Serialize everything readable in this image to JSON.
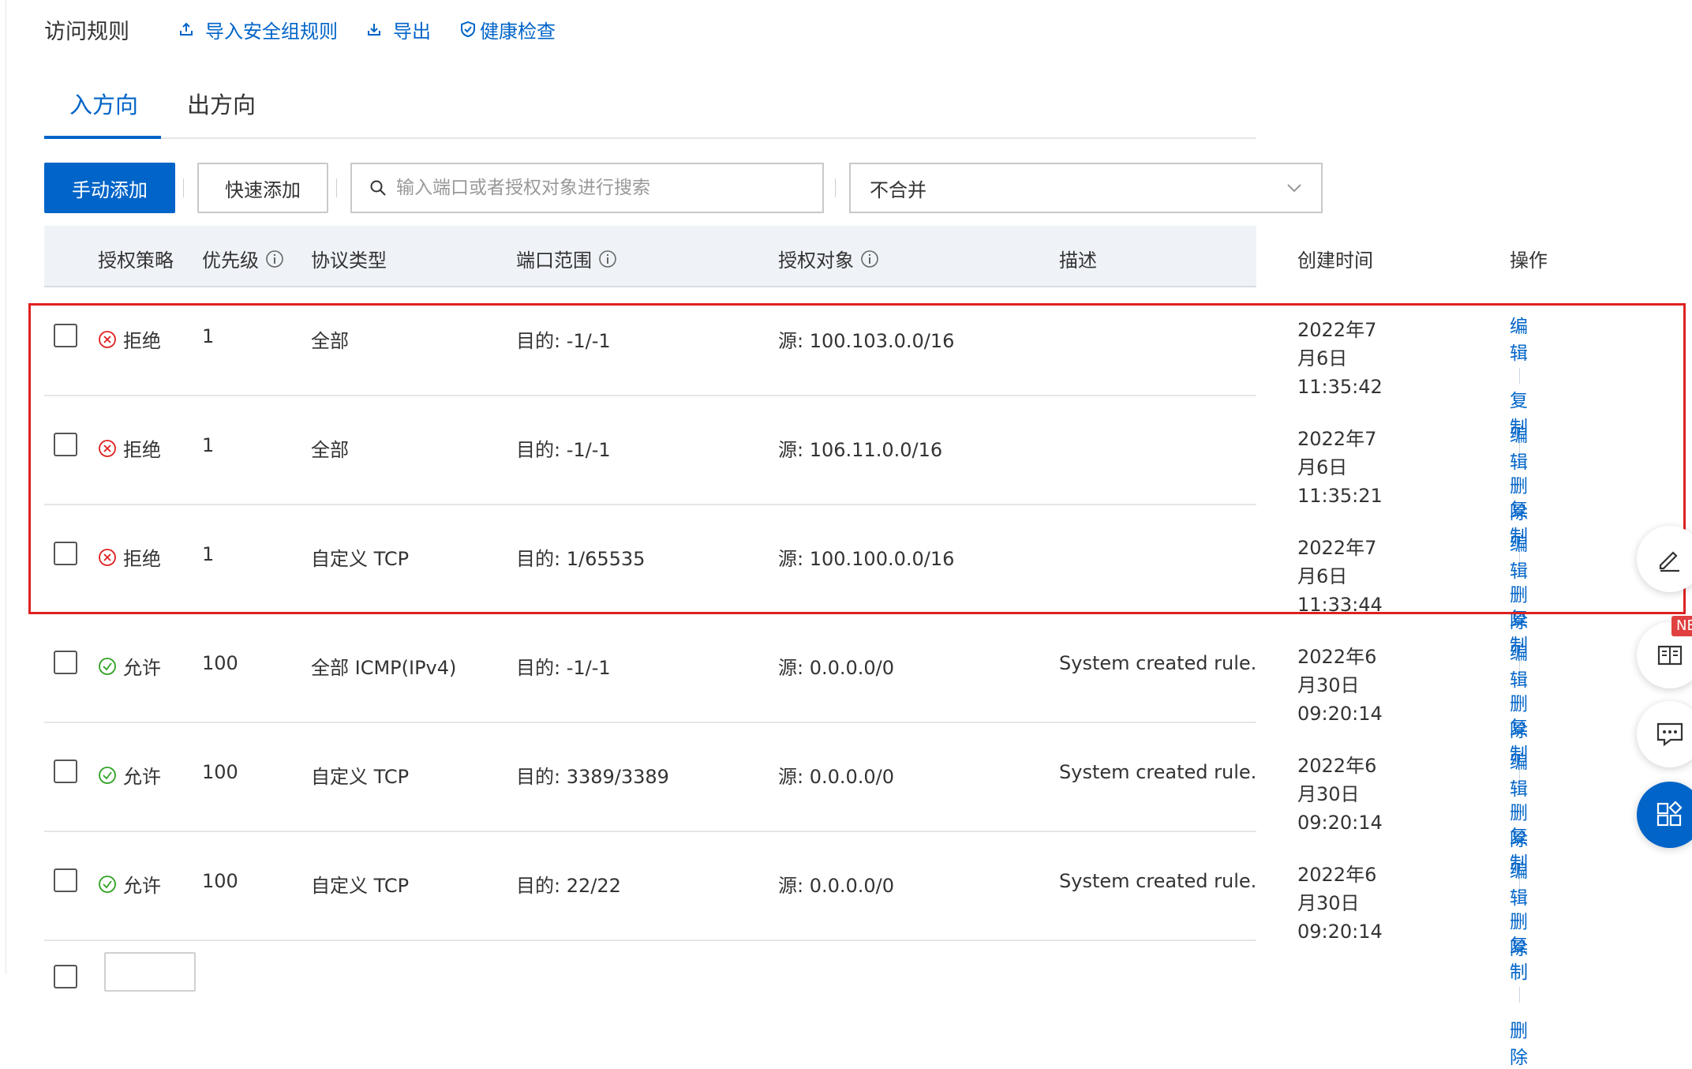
{
  "header": {
    "title": "访问规则",
    "import_label": "导入安全组规则",
    "export_label": "导出",
    "health_label": "健康检查"
  },
  "tabs": [
    {
      "label": "入方向",
      "active": true
    },
    {
      "label": "出方向",
      "active": false
    }
  ],
  "toolbar": {
    "manual_add": "手动添加",
    "quick_add": "快速添加",
    "search_placeholder": "输入端口或者授权对象进行搜索",
    "merge_select_value": "不合并"
  },
  "columns": {
    "policy": "授权策略",
    "priority": "优先级",
    "protocol": "协议类型",
    "port": "端口范围",
    "target": "授权对象",
    "desc": "描述",
    "created": "创建时间",
    "ops": "操作"
  },
  "ops_labels": {
    "edit": "编辑",
    "copy": "复制",
    "delete": "删除"
  },
  "rows": [
    {
      "policy": "拒绝",
      "policy_type": "deny",
      "priority": "1",
      "protocol": "全部",
      "port": "目的: -1/-1",
      "target": "源: 100.103.0.0/16",
      "desc": "",
      "date": "2022年7月6日",
      "time": "11:35:42"
    },
    {
      "policy": "拒绝",
      "policy_type": "deny",
      "priority": "1",
      "protocol": "全部",
      "port": "目的: -1/-1",
      "target": "源: 106.11.0.0/16",
      "desc": "",
      "date": "2022年7月6日",
      "time": "11:35:21"
    },
    {
      "policy": "拒绝",
      "policy_type": "deny",
      "priority": "1",
      "protocol": "自定义 TCP",
      "port": "目的: 1/65535",
      "target": "源: 100.100.0.0/16",
      "desc": "",
      "date": "2022年7月6日",
      "time": "11:33:44"
    },
    {
      "policy": "允许",
      "policy_type": "allow",
      "priority": "100",
      "protocol": "全部 ICMP(IPv4)",
      "port": "目的: -1/-1",
      "target": "源: 0.0.0.0/0",
      "desc": "System created rule.",
      "date": "2022年6月30日",
      "time": "09:20:14"
    },
    {
      "policy": "允许",
      "policy_type": "allow",
      "priority": "100",
      "protocol": "自定义 TCP",
      "port": "目的: 3389/3389",
      "target": "源: 0.0.0.0/0",
      "desc": "System created rule.",
      "date": "2022年6月30日",
      "time": "09:20:14"
    },
    {
      "policy": "允许",
      "policy_type": "allow",
      "priority": "100",
      "protocol": "自定义 TCP",
      "port": "目的: 22/22",
      "target": "源: 0.0.0.0/0",
      "desc": "System created rule.",
      "date": "2022年6月30日",
      "time": "09:20:14"
    }
  ],
  "side_badge": "NE",
  "colors": {
    "accent": "#0064c8",
    "deny": "#e02020",
    "allow": "#2ea121",
    "highlight": "#e02020"
  }
}
